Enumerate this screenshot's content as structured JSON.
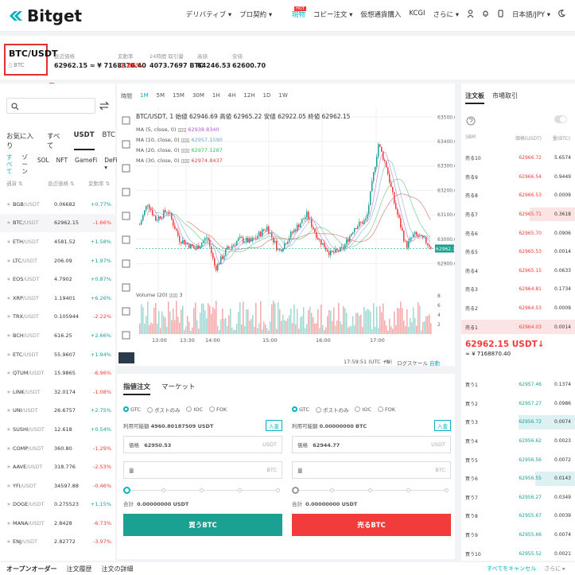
{
  "nav": {
    "logo": "Bitget",
    "links": [
      "デリバティブ ▾",
      "プロ契約 ▾",
      "現物",
      "コピー注文 ▾",
      "仮想通貨購入",
      "KCGI",
      "さらに ▾"
    ],
    "hot": "HOT",
    "lang": "日本語/JPY ▾",
    "accent": "#00b2c2"
  },
  "ticker": {
    "pair": "BTC/USDT",
    "sub": "BTC",
    "stats": [
      {
        "label": "直近価格",
        "value": "62962.15 ≈ ¥ 7168870.40"
      },
      {
        "label": "変動率",
        "value": "-1.66%"
      },
      {
        "label": "24時間 取引量",
        "value": "4073.7697 BTC"
      },
      {
        "label": "高値",
        "value": "64246.53"
      },
      {
        "label": "安値",
        "value": "62600.70"
      }
    ]
  },
  "market": {
    "search_placeholder": "",
    "tabs": [
      "お気に入り",
      "すべて",
      "USDT",
      "BTC"
    ],
    "subtabs": [
      "すべて",
      "ゾーン",
      "SOL",
      "NFT",
      "GameFi",
      "DeFi ▾"
    ],
    "headers": [
      "通貨 ⇅",
      "直近価格 ⇅",
      "変動率 ⇅"
    ],
    "rows": [
      {
        "base": "BGB",
        "quote": "/USDT",
        "price": "0.06682",
        "change": "+0.77%",
        "up": true
      },
      {
        "base": "BTC",
        "quote": "/USDT",
        "price": "62962.15",
        "change": "-1.66%",
        "up": false
      },
      {
        "base": "ETH",
        "quote": "/USDT",
        "price": "4581.52",
        "change": "+1.58%",
        "up": true
      },
      {
        "base": "LTC",
        "quote": "/USDT",
        "price": "206.09",
        "change": "+1.97%",
        "up": true
      },
      {
        "base": "EOS",
        "quote": "/USDT",
        "price": "4.7902",
        "change": "+0.87%",
        "up": true
      },
      {
        "base": "XRP",
        "quote": "/USDT",
        "price": "1.19401",
        "change": "+6.26%",
        "up": true
      },
      {
        "base": "TRX",
        "quote": "/USDT",
        "price": "0.105944",
        "change": "-2.22%",
        "up": false
      },
      {
        "base": "BCH",
        "quote": "/USDT",
        "price": "616.25",
        "change": "+2.66%",
        "up": true
      },
      {
        "base": "ETC",
        "quote": "/USDT",
        "price": "55.9607",
        "change": "+1.94%",
        "up": true
      },
      {
        "base": "QTUM",
        "quote": "/USDT",
        "price": "15.9865",
        "change": "-6.96%",
        "up": false
      },
      {
        "base": "LINK",
        "quote": "/USDT",
        "price": "32.0174",
        "change": "-1.08%",
        "up": false
      },
      {
        "base": "UNI",
        "quote": "/USDT",
        "price": "26.6757",
        "change": "+2.75%",
        "up": true
      },
      {
        "base": "SUSHI",
        "quote": "/USDT",
        "price": "12.618",
        "change": "+0.54%",
        "up": true
      },
      {
        "base": "COMP",
        "quote": "/USDT",
        "price": "360.80",
        "change": "-1.29%",
        "up": false
      },
      {
        "base": "AAVE",
        "quote": "/USDT",
        "price": "318.776",
        "change": "-2.53%",
        "up": false
      },
      {
        "base": "YFI",
        "quote": "/USDT",
        "price": "34597.88",
        "change": "-0.46%",
        "up": false
      },
      {
        "base": "DOGE",
        "quote": "/USDT",
        "price": "0.275523",
        "change": "+1.15%",
        "up": true
      },
      {
        "base": "MANA",
        "quote": "/USDT",
        "price": "2.8428",
        "change": "-6.73%",
        "up": false
      },
      {
        "base": "ENJ",
        "quote": "/USDT",
        "price": "2.82772",
        "change": "-3.97%",
        "up": false
      }
    ]
  },
  "chart": {
    "toolbar": [
      "時間",
      "1M",
      "5M",
      "15M",
      "30M",
      "1H",
      "4H",
      "12H",
      "1D",
      "1W"
    ],
    "ohlc_line": "BTC/USDT, 1  始値 62946.69  高値 62965.22  安値 62922.05  終値 62962.15",
    "ma": [
      {
        "label": "MA (5, close, 0)",
        "value": "62938.8340",
        "color": "#b05ad0"
      },
      {
        "label": "MA (10, close, 0)",
        "value": "62957.1590",
        "color": "#6aa8c8"
      },
      {
        "label": "MA (20, close, 0)",
        "value": "62977.1287",
        "color": "#3cbf5a"
      },
      {
        "label": "MA (30, close, 0)",
        "value": "62974.8437",
        "color": "#d04a4a"
      }
    ],
    "volume_label": "Volume (20)",
    "volume_value": "3",
    "price_tag": "62962.15",
    "time_text": "17:59:51 (UTC +9)",
    "footer_items": [
      "%",
      "ログスケール",
      "自動"
    ]
  },
  "chart_data": {
    "type": "candlestick",
    "x_ticks": [
      "13:00",
      "13:30",
      "14:00",
      "15:00",
      "16:00",
      "17:00"
    ],
    "y_ticks": [
      62900,
      63000,
      63100,
      63200,
      63300,
      63400,
      63500
    ],
    "ylim": [
      62840,
      63540
    ],
    "vol_ticks": [
      2,
      4,
      6,
      8
    ],
    "last": 62962.15
  },
  "order": {
    "tabs": [
      "指値注文",
      "マーケット"
    ],
    "radios": [
      "GTC",
      "ポストのみ",
      "IOC",
      "FOK"
    ],
    "buy": {
      "avail_label": "利用可能額",
      "avail": "4960.80187509 USDT",
      "deposit": "入金",
      "price_label": "価格",
      "price": "62950.53",
      "price_unit": "USDT",
      "qty_label": "量",
      "qty_unit": "BTC",
      "total_label": "合計",
      "total": "0.00000000 USDT",
      "button": "買うBTC",
      "color": "#1aa192"
    },
    "sell": {
      "avail_label": "利用可能額",
      "avail": "0.00000000 BTC",
      "deposit": "入金",
      "price_label": "価格",
      "price": "62944.77",
      "price_unit": "USDT",
      "qty_label": "量",
      "qty_unit": "BTC",
      "total_label": "合計",
      "total": "0.00000000 USDT",
      "button": "売るBTC",
      "color": "#f23b3b"
    }
  },
  "book": {
    "tabs": [
      "注文板",
      "市場取引"
    ],
    "headers": [
      "SBM",
      "価格(USDT)",
      "量(BTC)"
    ],
    "asks": [
      {
        "label": "売る10",
        "price": "62966.72",
        "qty": "5.6574",
        "depth": 0.0
      },
      {
        "label": "売る9",
        "price": "62966.54",
        "qty": "0.9449",
        "depth": 0.0
      },
      {
        "label": "売る8",
        "price": "62966.53",
        "qty": "0.0009",
        "depth": 0.0
      },
      {
        "label": "売る7",
        "price": "62965.71",
        "qty": "0.3618",
        "depth": 0.4
      },
      {
        "label": "売る6",
        "price": "62965.70",
        "qty": "0.0906",
        "depth": 0.0
      },
      {
        "label": "売る5",
        "price": "62965.53",
        "qty": "0.0014",
        "depth": 0.0
      },
      {
        "label": "売る4",
        "price": "62965.15",
        "qty": "0.0633",
        "depth": 0.0
      },
      {
        "label": "売る3",
        "price": "62964.81",
        "qty": "0.1734",
        "depth": 0.0
      },
      {
        "label": "売る2",
        "price": "62964.53",
        "qty": "0.0009",
        "depth": 0.0
      },
      {
        "label": "売る1",
        "price": "62964.03",
        "qty": "0.0014",
        "depth": 1.0
      }
    ],
    "mid_price": "62962.15 USDT↓",
    "mid_sub": "≈ ¥ 7168870.40",
    "bids": [
      {
        "label": "買う1",
        "price": "62957.46",
        "qty": "0.1374",
        "depth": 0.0
      },
      {
        "label": "買う2",
        "price": "62957.27",
        "qty": "0.0986",
        "depth": 0.0
      },
      {
        "label": "買う3",
        "price": "62956.72",
        "qty": "0.0074",
        "depth": 0.5
      },
      {
        "label": "買う4",
        "price": "62956.62",
        "qty": "0.0023",
        "depth": 0.0
      },
      {
        "label": "買う5",
        "price": "62956.56",
        "qty": "0.0072",
        "depth": 0.0
      },
      {
        "label": "買う6",
        "price": "62956.55",
        "qty": "0.0143",
        "depth": 0.35
      },
      {
        "label": "買う7",
        "price": "62956.27",
        "qty": "0.0349",
        "depth": 0.0
      },
      {
        "label": "買う8",
        "price": "62955.67",
        "qty": "0.0039",
        "depth": 0.0
      },
      {
        "label": "買う9",
        "price": "62955.66",
        "qty": "0.0074",
        "depth": 0.0
      },
      {
        "label": "買う10",
        "price": "62955.52",
        "qty": "0.0021",
        "depth": 0.0
      }
    ]
  },
  "bottom": {
    "tabs": [
      "オープンオーダー",
      "注文履歴",
      "注文の詳細"
    ],
    "right": [
      "すべてをキャンセル",
      "さらに ▸"
    ]
  }
}
